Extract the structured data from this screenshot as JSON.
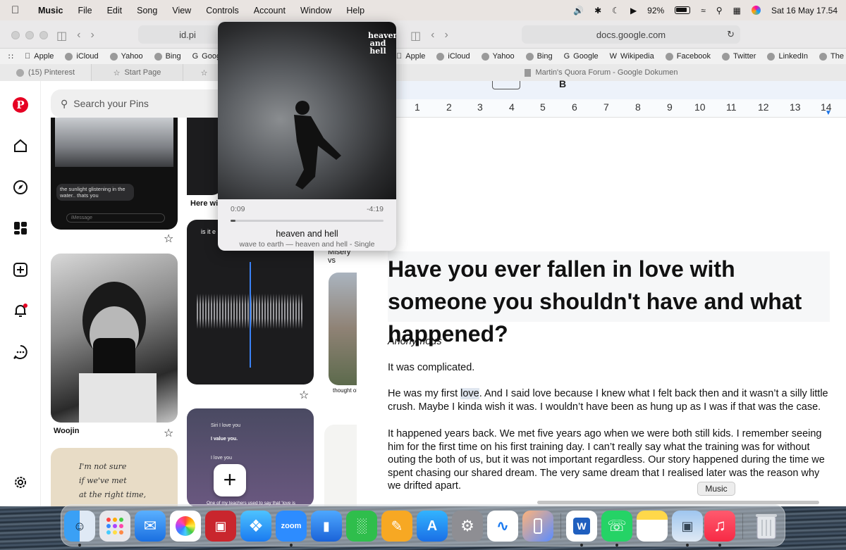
{
  "menubar": {
    "app_name": "Music",
    "items": [
      "File",
      "Edit",
      "Song",
      "View",
      "Controls",
      "Account",
      "Window",
      "Help"
    ],
    "battery": "92%",
    "clock": "Sat 16 May  17.54"
  },
  "left_browser": {
    "url": "id.pi",
    "favorites": [
      "Apple",
      "iCloud",
      "Yahoo",
      "Bing",
      "Google"
    ],
    "tabs": [
      "(15) Pinterest",
      "Start Page"
    ]
  },
  "pinterest": {
    "search_placeholder": "Search your Pins",
    "pin1_caption": "the sunlight glistening in the water.. thats you",
    "pin1_input": "iMessage",
    "pin2_caption": "Here wit",
    "pin3_caption": "Woojin",
    "pin4_text_top": "is it e",
    "pin5_caption": "Misery vs",
    "pin6_caption": "thought ol",
    "pin7_lines": [
      "Siri I love you",
      "I value you.",
      "I love you",
      "One of my teachers used to say that 'love is"
    ],
    "pin8_note": [
      "I'm not sure",
      "if we've met",
      "at the right time,"
    ]
  },
  "player": {
    "elapsed": "0:09",
    "remaining": "-4:19",
    "progress": 0.03,
    "title": "heaven and hell",
    "subtitle": "wave to earth — heaven and hell - Single",
    "art_text": "heaven and hell"
  },
  "right_browser": {
    "url": "docs.google.com",
    "favorites": [
      "Apple",
      "iCloud",
      "Yahoo",
      "Bing",
      "Google",
      "Wikipedia",
      "Facebook",
      "Twitter",
      "LinkedIn",
      "The Weather Chan"
    ],
    "tab_title": "Martin's Quora Forum - Google Dokumen"
  },
  "doc": {
    "ruler": [
      "1",
      "2",
      "3",
      "4",
      "5",
      "6",
      "7",
      "8",
      "9",
      "10",
      "11",
      "12",
      "13",
      "14"
    ],
    "heading": "Have you ever fallen in love with someone you shouldn't have and what happened?",
    "author": "Anonymous",
    "p1": "It was complicated.",
    "p2_a": "He was my first ",
    "p2_hl": "love",
    "p2_b": ". And I said love because I knew what I felt back then and it wasn’t a silly little crush. Maybe I kinda wish it was. I wouldn’t have been as hung up as I was if that was the case.",
    "p3": "It happened years back. We met five years ago when we were both still kids. I remember seeing him for the first time on his first training day. I can’t really say what the training was for without outing the both of us, but it was not important regardless. Our story happened during the time we spent chasing our shared dream. The very same dream that I realised later was the reason why we drifted apart."
  },
  "dock": {
    "tooltip": "Music",
    "apps": [
      "Finder",
      "Launchpad",
      "Mail",
      "Photos",
      "Photo Booth",
      "Safari",
      "Zoom",
      "Keynote",
      "Numbers",
      "Pages",
      "App Store",
      "System Settings",
      "Freeform",
      "iPhone Mirroring",
      "Microsoft Word",
      "WhatsApp",
      "Notes",
      "Preview",
      "Music",
      "Trash"
    ],
    "zoom_label": "zoom"
  }
}
